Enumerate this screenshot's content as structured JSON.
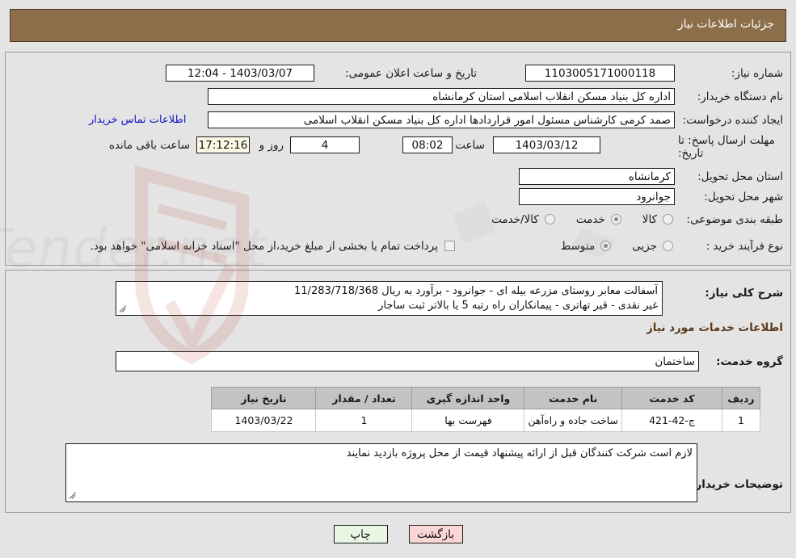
{
  "header": {
    "title": "جزئیات اطلاعات نیاز"
  },
  "top_form": {
    "need_number_label": "شماره نیاز:",
    "need_number_value": "1103005171000118",
    "announce_datetime_label": "تاریخ و ساعت اعلان عمومی:",
    "announce_datetime_value": "1403/03/07 - 12:04",
    "buyer_org_label": "نام دستگاه خریدار:",
    "buyer_org_value": "اداره کل بنیاد مسکن انقلاب اسلامی استان کرمانشاه",
    "requester_label": "ایجاد کننده درخواست:",
    "requester_value": "صمد کرمی کارشناس مسئول امور قراردادها اداره کل بنیاد مسکن انقلاب اسلامی",
    "contact_link": "اطلاعات تماس خریدار",
    "deadline_label_line1": "مهلت ارسال پاسخ: تا",
    "deadline_label_line2": "تاریخ:",
    "deadline_date": "1403/03/12",
    "hour_word": "ساعت",
    "deadline_time": "08:02",
    "days_remaining": "4",
    "days_word": "روز و",
    "countdown": "17:12:16",
    "remaining_suffix": "ساعت باقی مانده",
    "province_label": "استان محل تحویل:",
    "province_value": "کرمانشاه",
    "city_label": "شهر محل تحویل:",
    "city_value": "جوانرود",
    "category_label": "طبقه بندی موضوعی:",
    "category_options": [
      {
        "label": "کالا",
        "selected": false
      },
      {
        "label": "خدمت",
        "selected": true
      },
      {
        "label": "کالا/خدمت",
        "selected": false
      }
    ],
    "process_label": "نوع فرآیند خرید :",
    "process_options": [
      {
        "label": "جزیی",
        "selected": false
      },
      {
        "label": "متوسط",
        "selected": true
      }
    ],
    "treasury_checkbox_label": "پرداخت تمام یا بخشی از مبلغ خرید،از محل \"اسناد خزانه اسلامی\" خواهد بود.",
    "treasury_checked": false
  },
  "description": {
    "label": "شرح کلی نیاز:",
    "line1": "آسفالت معابر روستای مزرعه بیله ای - جوانرود - برآورد به ریال  11/283/718/368",
    "line2": "غیر نقدی - قیر تهاتری - پیمانکاران راه رتبه 5 یا بالاتر ثبت ساجار"
  },
  "services_section": {
    "heading": "اطلاعات خدمات مورد نیاز",
    "service_group_label": "گروه خدمت:",
    "service_group_value": "ساختمان"
  },
  "table": {
    "columns": [
      "ردیف",
      "کد خدمت",
      "نام خدمت",
      "واحد اندازه گیری",
      "تعداد / مقدار",
      "تاریخ نیاز"
    ],
    "rows": [
      {
        "index": "1",
        "code": "ج-42-421",
        "name": "ساخت جاده و راه‌آهن",
        "unit": "فهرست بها",
        "quantity": "1",
        "need_date": "1403/03/22"
      }
    ]
  },
  "buyer_notes": {
    "label": "توضیحات خریدار:",
    "value": "لازم است شرکت کنندگان قبل از ارائه پیشنهاد قیمت از محل پروژه بازدید نمایند"
  },
  "footer": {
    "print_label": "چاپ",
    "back_label": "بازگشت"
  },
  "colors": {
    "header_bg": "#8d6e4b",
    "page_bg": "#e4e4e4",
    "link": "#1414c8",
    "table_header_bg": "#c3c3c3",
    "print_btn_bg": "#e8f6e3",
    "back_btn_bg": "#fbd6d6",
    "countdown_bg": "#fbf8e3"
  }
}
